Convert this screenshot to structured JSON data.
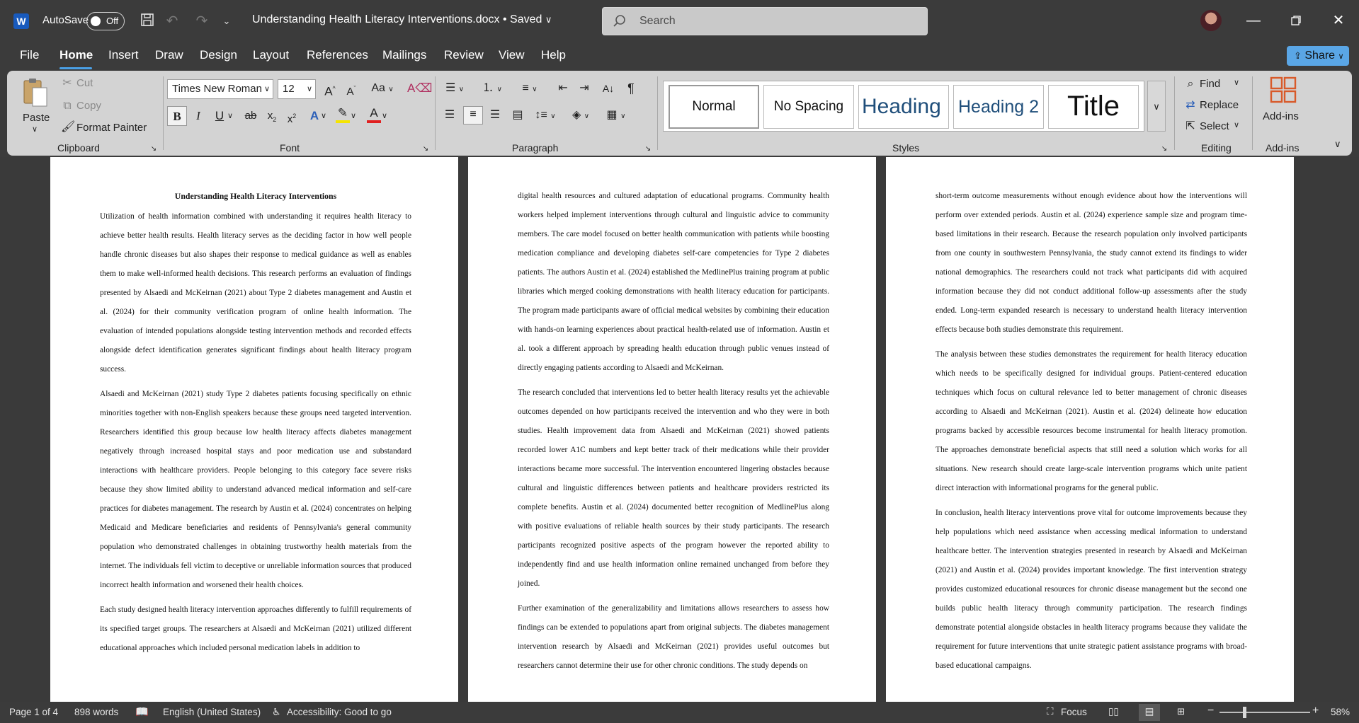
{
  "titlebar": {
    "app_logo": "W",
    "autosave_label": "AutoSave",
    "autosave_state": "Off",
    "document_title": "Understanding Health Literacy Interventions.docx • Saved",
    "search_placeholder": "Search"
  },
  "menu": {
    "items": [
      "File",
      "Home",
      "Insert",
      "Draw",
      "Design",
      "Layout",
      "References",
      "Mailings",
      "Review",
      "View",
      "Help"
    ],
    "active": "Home",
    "share_label": "Share"
  },
  "ribbon": {
    "clipboard": {
      "label": "Clipboard",
      "paste": "Paste",
      "cut": "Cut",
      "copy": "Copy",
      "format_painter": "Format Painter"
    },
    "font": {
      "label": "Font",
      "family": "Times New Roman",
      "size": "12"
    },
    "paragraph": {
      "label": "Paragraph"
    },
    "styles": {
      "label": "Styles",
      "items": [
        "Normal",
        "No Spacing",
        "Heading 1",
        "Heading 2",
        "Title"
      ]
    },
    "editing": {
      "label": "Editing",
      "find": "Find",
      "replace": "Replace",
      "select": "Select"
    },
    "addins": {
      "label": "Add-ins",
      "button": "Add-ins"
    }
  },
  "pages": [
    {
      "title": "Understanding Health Literacy Interventions",
      "paragraphs": [
        "Utilization of health information combined with understanding it requires health literacy to achieve better health results. Health literacy serves as the deciding factor in how well people handle chronic diseases but also shapes their response to medical guidance as well as enables them to make well-informed health decisions. This research performs an evaluation of findings presented by Alsaedi and McKeirnan (2021) about Type 2 diabetes management and Austin et al. (2024) for their community verification program of online health information. The evaluation of intended populations alongside testing intervention methods and recorded effects alongside defect identification generates significant findings about health literacy program success.",
        "Alsaedi and McKeirnan (2021) study Type 2 diabetes patients focusing specifically on ethnic minorities together with non-English speakers because these groups need targeted intervention. Researchers identified this group because low health literacy affects diabetes management negatively through increased hospital stays and poor medication use and substandard interactions with healthcare providers. People belonging to this category face severe risks because they show limited ability to understand advanced medical information and self-care practices for diabetes management. The research by Austin et al. (2024) concentrates on helping Medicaid and Medicare beneficiaries and residents of Pennsylvania's general community population who demonstrated challenges in obtaining trustworthy health materials from the internet. The individuals fell victim to deceptive or unreliable information sources that produced incorrect health information and worsened their health choices.",
        "Each study designed health literacy intervention approaches differently to fulfill requirements of its specified target groups. The researchers at Alsaedi and McKeirnan (2021) utilized different educational approaches which included personal medication labels in addition to"
      ]
    },
    {
      "title": "",
      "paragraphs": [
        "digital health resources and cultured adaptation of educational programs. Community health workers helped implement interventions through cultural and linguistic advice to community members. The care model focused on better health communication with patients while boosting medication compliance and developing diabetes self-care competencies for Type 2 diabetes patients. The authors Austin et al. (2024) established the MedlinePlus training program at public libraries which merged cooking demonstrations with health literacy education for participants. The program made participants aware of official medical websites by combining their education with hands-on learning experiences about practical health-related use of information. Austin et al. took a different approach by spreading health education through public venues instead of directly engaging patients according to Alsaedi and McKeirnan.",
        "The research concluded that interventions led to better health literacy results yet the achievable outcomes depended on how participants received the intervention and who they were in both studies. Health improvement data from Alsaedi and McKeirnan (2021) showed patients recorded lower A1C numbers and kept better track of their medications while their provider interactions became more successful. The intervention encountered lingering obstacles because cultural and linguistic differences between patients and healthcare providers restricted its complete benefits. Austin et al. (2024) documented better recognition of MedlinePlus along with positive evaluations of reliable health sources by their study participants. The research participants recognized positive aspects of the program however the reported ability to independently find and use health information online remained unchanged from before they joined.",
        "Further examination of the generalizability and limitations allows researchers to assess how findings can be extended to populations apart from original subjects. The diabetes management intervention research by Alsaedi and McKeirnan (2021) provides useful outcomes but researchers cannot determine their use for other chronic conditions. The study depends on"
      ]
    },
    {
      "title": "",
      "paragraphs": [
        "short-term outcome measurements without enough evidence about how the interventions will perform over extended periods. Austin et al. (2024) experience sample size and program time-based limitations in their research. Because the research population only involved participants from one county in southwestern Pennsylvania, the study cannot extend its findings to wider national demographics. The researchers could not track what participants did with acquired information because they did not conduct additional follow-up assessments after the study ended. Long-term expanded research is necessary to understand health literacy intervention effects because both studies demonstrate this requirement.",
        "The analysis between these studies demonstrates the requirement for health literacy education which needs to be specifically designed for individual groups. Patient-centered education techniques which focus on cultural relevance led to better management of chronic diseases according to Alsaedi and McKeirnan (2021). Austin et al. (2024) delineate how education programs backed by accessible resources become instrumental for health literacy promotion. The approaches demonstrate beneficial aspects that still need a solution which works for all situations. New research should create large-scale intervention programs which unite patient direct interaction with informational programs for the general public.",
        "In conclusion, health literacy interventions prove vital for outcome improvements because they help populations which need assistance when accessing medical information to understand healthcare better. The intervention strategies presented in research by Alsaedi and McKeirnan (2021) and Austin et al. (2024) provides important knowledge. The first intervention strategy provides customized educational resources for chronic disease management but the second one builds public health literacy through community participation. The research findings demonstrate potential alongside obstacles in health literacy programs because they validate the requirement for future interventions that unite strategic patient assistance programs with broad-based educational campaigns."
      ]
    }
  ],
  "statusbar": {
    "page": "Page 1 of 4",
    "words": "898 words",
    "language": "English (United States)",
    "accessibility": "Accessibility: Good to go",
    "focus": "Focus",
    "zoom": "58%"
  },
  "colors": {
    "accent": "#4aa0e6",
    "word_blue": "#185abd",
    "chrome": "#3b3b3b",
    "ribbon": "#d3d3d3"
  }
}
